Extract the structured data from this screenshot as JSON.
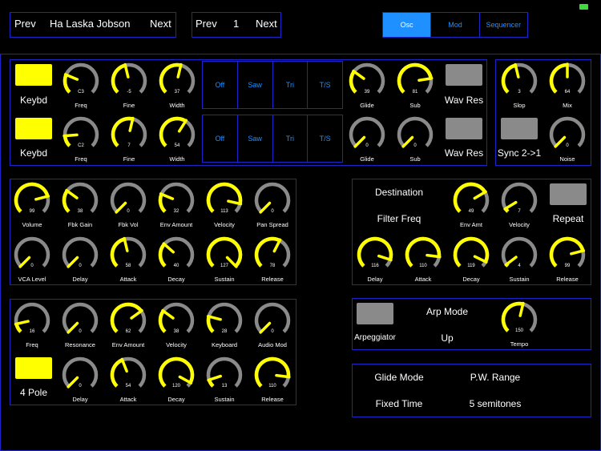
{
  "status": {
    "battery_color": "#3ddc3d"
  },
  "preset_nav": {
    "prev": "Prev",
    "name": "Ha Laska Jobson",
    "next": "Next"
  },
  "bank_nav": {
    "prev": "Prev",
    "number": "1",
    "next": "Next"
  },
  "mode_tabs": [
    {
      "label": "Osc",
      "active": true
    },
    {
      "label": "Mod",
      "active": false
    },
    {
      "label": "Sequencer",
      "active": false
    }
  ],
  "colors": {
    "accent": "#1e90ff",
    "border": "#1e24c8",
    "knob_value": "#ffff00",
    "knob_track": "#8a8a8a"
  },
  "osc": {
    "row1": {
      "keybd": "Keybd",
      "freq": {
        "label": "Freq",
        "value": "C3",
        "level": 0.25
      },
      "fine": {
        "label": "Fine",
        "value": "-5",
        "level": 0.45
      },
      "width": {
        "label": "Width",
        "value": "37",
        "level": 0.55
      },
      "waves": [
        "Off",
        "Saw",
        "Tri",
        "T/S"
      ],
      "glide": {
        "label": "Glide",
        "value": "39",
        "level": 0.3
      },
      "sub": {
        "label": "Sub",
        "value": "81",
        "level": 0.8
      },
      "wav_res": "Wav Res"
    },
    "row2": {
      "keybd": "Keybd",
      "freq": {
        "label": "Freq",
        "value": "C2",
        "level": 0.15
      },
      "fine": {
        "label": "Fine",
        "value": "7",
        "level": 0.55
      },
      "width": {
        "label": "Width",
        "value": "54",
        "level": 0.62
      },
      "waves": [
        "Off",
        "Saw",
        "Tri",
        "T/S"
      ],
      "glide": {
        "label": "Glide",
        "value": "0",
        "level": 0.0
      },
      "sub": {
        "label": "Sub",
        "value": "0",
        "level": 0.0
      },
      "wav_res": "Wav Res"
    },
    "mix": {
      "slop": {
        "label": "Slop",
        "value": "3",
        "level": 0.45
      },
      "mix": {
        "label": "Mix",
        "value": "64",
        "level": 0.5
      },
      "sync": "Sync 2->1",
      "noise": {
        "label": "Noise",
        "value": "0",
        "level": 0.0
      }
    }
  },
  "amp": {
    "row1": [
      {
        "label": "Volume",
        "value": "99",
        "level": 0.78
      },
      {
        "label": "Fbk Gain",
        "value": "38",
        "level": 0.3
      },
      {
        "label": "Fbk Vol",
        "value": "0",
        "level": 0.0
      },
      {
        "label": "Env Amount",
        "value": "32",
        "level": 0.25
      },
      {
        "label": "Velocity",
        "value": "113",
        "level": 0.88
      },
      {
        "label": "Pan Spread",
        "value": "0",
        "level": 0.0
      }
    ],
    "row2": [
      {
        "label": "VCA Level",
        "value": "0",
        "level": 0.0
      },
      {
        "label": "Delay",
        "value": "0",
        "level": 0.0
      },
      {
        "label": "Attack",
        "value": "58",
        "level": 0.45
      },
      {
        "label": "Decay",
        "value": "40",
        "level": 0.32
      },
      {
        "label": "Sustain",
        "value": "127",
        "level": 1.0
      },
      {
        "label": "Release",
        "value": "78",
        "level": 0.6
      }
    ]
  },
  "mod_env": {
    "destination_label": "Destination",
    "destination_value": "Filter Freq",
    "env_amt": {
      "label": "Env Amt",
      "value": "49",
      "level": 0.72
    },
    "velocity": {
      "label": "Velocity",
      "value": "7",
      "level": 0.05
    },
    "repeat": "Repeat",
    "row2": [
      {
        "label": "Delay",
        "value": "116",
        "level": 0.9
      },
      {
        "label": "Attack",
        "value": "110",
        "level": 0.86
      },
      {
        "label": "Decay",
        "value": "119",
        "level": 0.93
      },
      {
        "label": "Sustain",
        "value": "4",
        "level": 0.03
      },
      {
        "label": "Release",
        "value": "99",
        "level": 0.78
      }
    ]
  },
  "filter": {
    "row1": [
      {
        "label": "Freq",
        "value": "16",
        "level": 0.12
      },
      {
        "label": "Resonance",
        "value": "0",
        "level": 0.0
      },
      {
        "label": "Env Amount",
        "value": "62",
        "level": 0.7
      },
      {
        "label": "Velocity",
        "value": "38",
        "level": 0.3
      },
      {
        "label": "Keyboard",
        "value": "28",
        "level": 0.22
      },
      {
        "label": "Audio Mod",
        "value": "0",
        "level": 0.0
      }
    ],
    "four_pole": "4 Pole",
    "row2": [
      {
        "label": "Delay",
        "value": "0",
        "level": 0.0
      },
      {
        "label": "Attack",
        "value": "54",
        "level": 0.42
      },
      {
        "label": "Decay",
        "value": "120",
        "level": 0.94
      },
      {
        "label": "Sustain",
        "value": "13",
        "level": 0.1
      },
      {
        "label": "Release",
        "value": "110",
        "level": 0.86
      }
    ]
  },
  "arp": {
    "arpeggiator": "Arpeggiator",
    "mode_label": "Arp Mode",
    "mode_value": "Up",
    "tempo": {
      "label": "Tempo",
      "value": "150",
      "level": 0.55
    }
  },
  "misc": {
    "glide_mode_label": "Glide Mode",
    "glide_mode_value": "Fixed Time",
    "pw_range_label": "P.W. Range",
    "pw_range_value": "5 semitones"
  }
}
